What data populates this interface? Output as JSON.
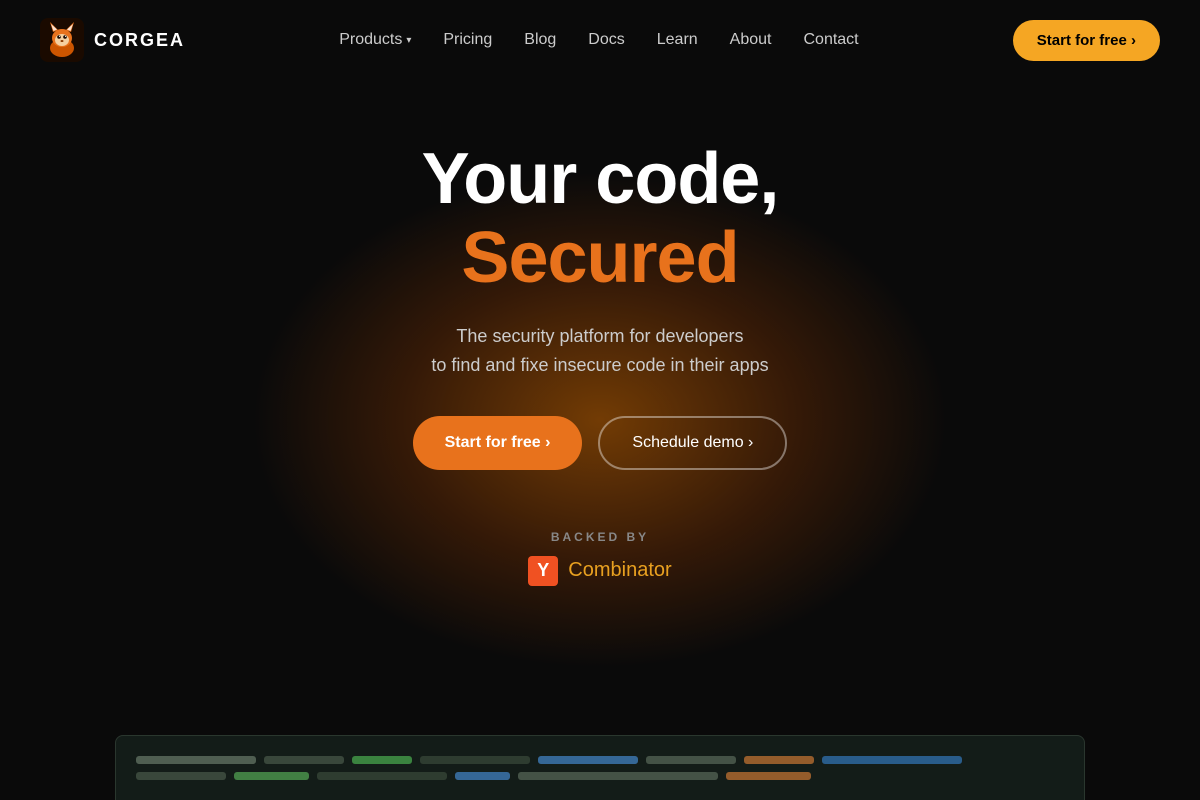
{
  "brand": {
    "name": "CORGEA",
    "logo_alt": "Corgea fox logo"
  },
  "navbar": {
    "links": [
      {
        "id": "products",
        "label": "Products",
        "has_dropdown": true
      },
      {
        "id": "pricing",
        "label": "Pricing",
        "has_dropdown": false
      },
      {
        "id": "blog",
        "label": "Blog",
        "has_dropdown": false
      },
      {
        "id": "docs",
        "label": "Docs",
        "has_dropdown": false
      },
      {
        "id": "learn",
        "label": "Learn",
        "has_dropdown": false
      },
      {
        "id": "about",
        "label": "About",
        "has_dropdown": false
      },
      {
        "id": "contact",
        "label": "Contact",
        "has_dropdown": false
      }
    ],
    "cta_label": "Start for free ›"
  },
  "hero": {
    "title_white": "Your code,",
    "title_orange": "Secured",
    "subtitle_line1": "The security platform for developers",
    "subtitle_line2": "to find and fixe insecure code in their apps",
    "btn_primary_label": "Start for free ›",
    "btn_secondary_label": "Schedule demo ›"
  },
  "backed_by": {
    "label": "BACKED  BY",
    "yc_letter": "Y",
    "yc_name": "Combinator"
  },
  "colors": {
    "orange": "#e8721c",
    "yc_orange": "#f05122",
    "yc_text_orange": "#e8a020",
    "nav_cta_bg": "#f5a623"
  }
}
